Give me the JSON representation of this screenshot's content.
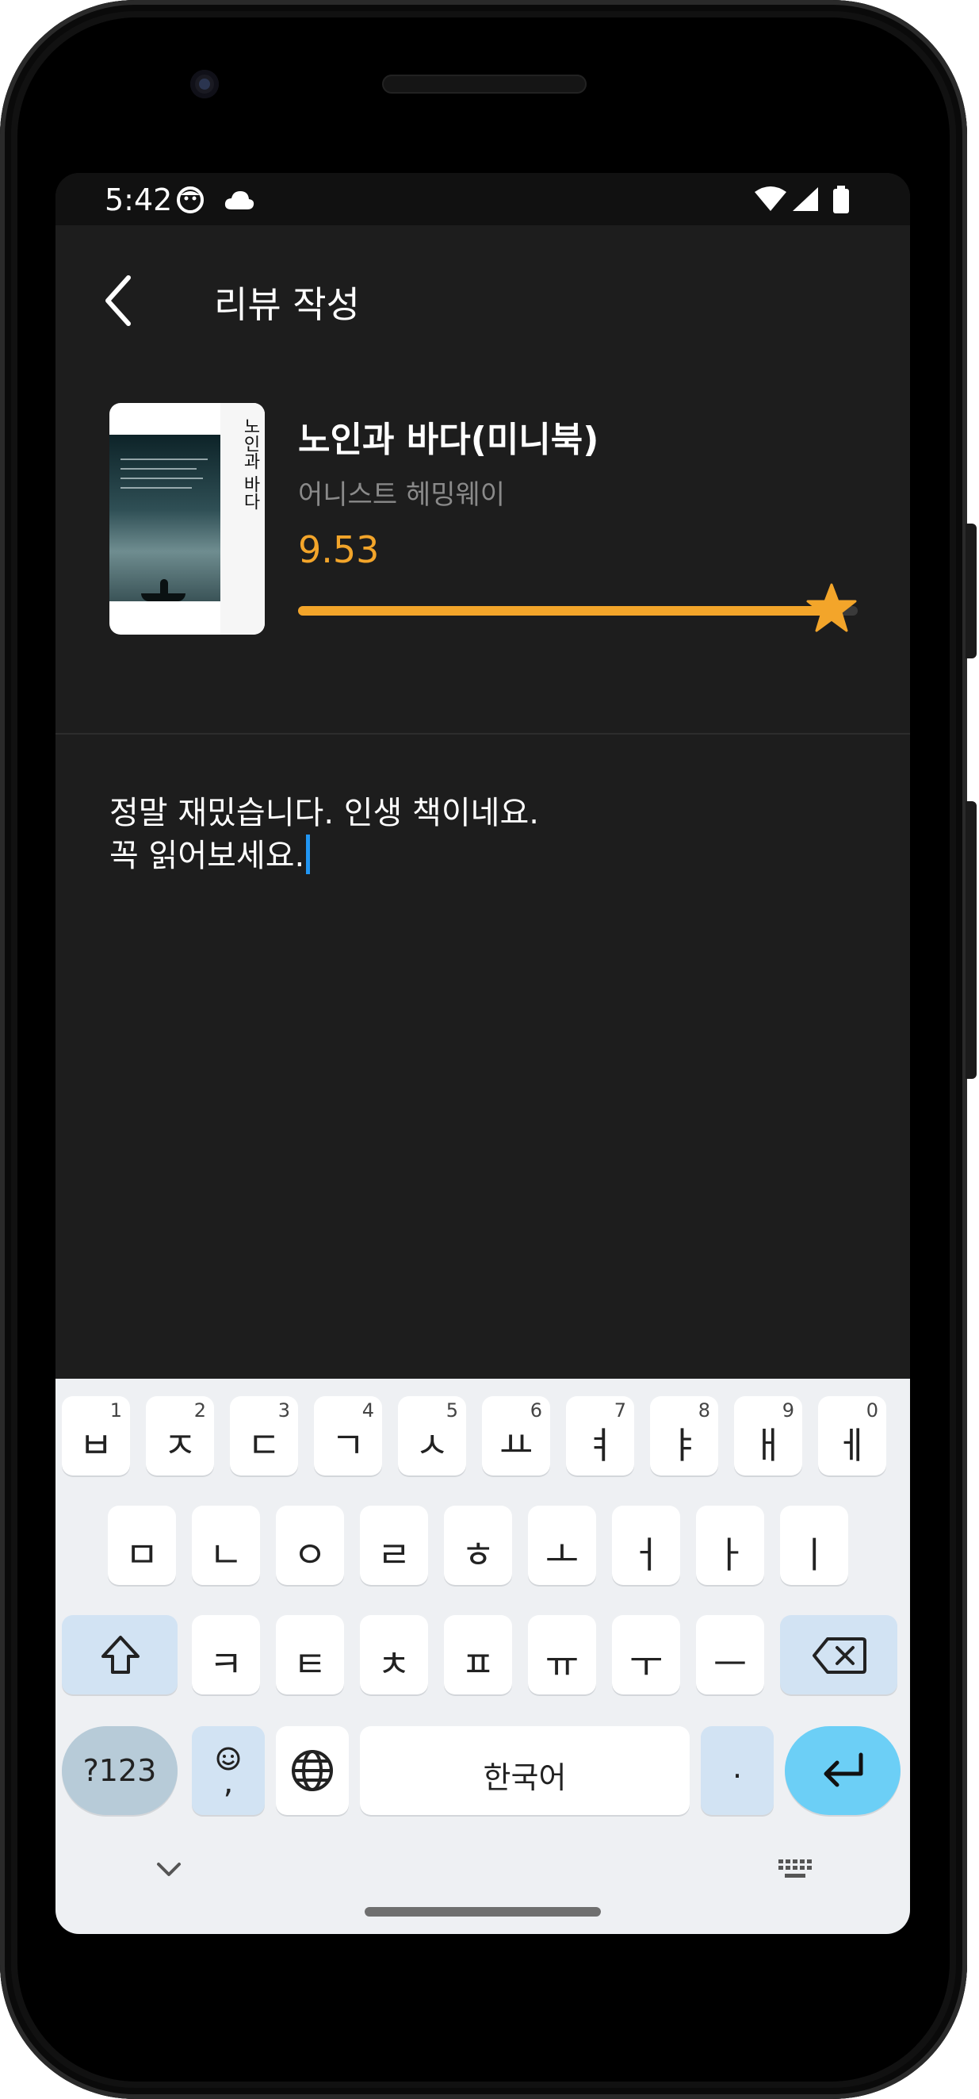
{
  "status_bar": {
    "time": "5:42"
  },
  "app_bar": {
    "title": "리뷰 작성"
  },
  "book": {
    "title": "노인과 바다(미니북)",
    "author": "어니스트 헤밍웨이",
    "cover_title": "노인과 바다",
    "rating_text": "9.53",
    "rating_fraction": 0.953
  },
  "review": {
    "line1": "정말 재밌습니다. 인생 책이네요.",
    "line2": "꼭 읽어보세요."
  },
  "keyboard": {
    "row1": [
      {
        "key": "ㅂ",
        "hint": "1"
      },
      {
        "key": "ㅈ",
        "hint": "2"
      },
      {
        "key": "ㄷ",
        "hint": "3"
      },
      {
        "key": "ㄱ",
        "hint": "4"
      },
      {
        "key": "ㅅ",
        "hint": "5"
      },
      {
        "key": "ㅛ",
        "hint": "6"
      },
      {
        "key": "ㅕ",
        "hint": "7"
      },
      {
        "key": "ㅑ",
        "hint": "8"
      },
      {
        "key": "ㅐ",
        "hint": "9"
      },
      {
        "key": "ㅔ",
        "hint": "0"
      }
    ],
    "row2": [
      "ㅁ",
      "ㄴ",
      "ㅇ",
      "ㄹ",
      "ㅎ",
      "ㅗ",
      "ㅓ",
      "ㅏ",
      "ㅣ"
    ],
    "row3": [
      "ㅋ",
      "ㅌ",
      "ㅊ",
      "ㅍ",
      "ㅠ",
      "ㅜ",
      "ㅡ"
    ],
    "symbols_label": "?123",
    "emoji_comma_label": ",",
    "space_label": "한국어",
    "period_label": "."
  },
  "colors": {
    "accent": "#f3a52a",
    "cursor": "#2196f3",
    "background": "#1d1d1d"
  },
  "icons": [
    "back-arrow-icon",
    "star-icon",
    "shift-icon",
    "backspace-icon",
    "globe-icon",
    "emoji-icon",
    "enter-icon",
    "chevron-down-icon",
    "keyboard-icon",
    "wifi-icon",
    "signal-icon",
    "battery-icon",
    "cloud-icon",
    "face-icon"
  ]
}
